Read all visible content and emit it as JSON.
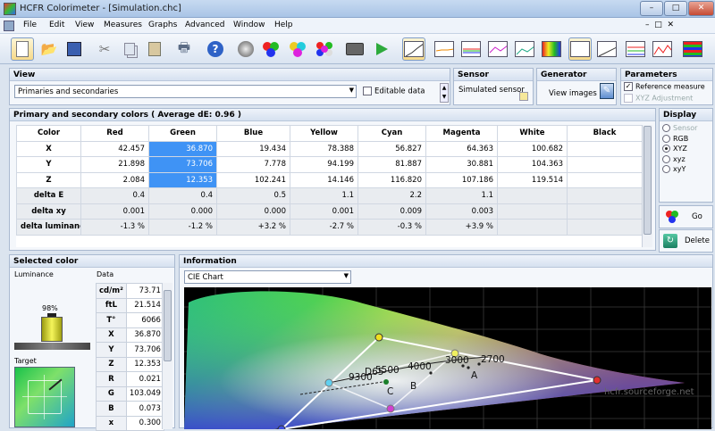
{
  "window": {
    "title": "HCFR Colorimeter - [Simulation.chc]",
    "min": "–",
    "max": "□",
    "close": "✕"
  },
  "menu": [
    "File",
    "Edit",
    "View",
    "Measures",
    "Graphs",
    "Advanced",
    "Window",
    "Help"
  ],
  "view": {
    "header": "View",
    "select": "Primaries and secondaries",
    "editable_label": "Editable data"
  },
  "sensor": {
    "header": "Sensor",
    "label": "Simulated sensor"
  },
  "generator": {
    "header": "Generator",
    "label": "View images"
  },
  "parameters": {
    "header": "Parameters",
    "reference": "Reference measure",
    "xyz_adj": "XYZ Adjustment"
  },
  "primaries": {
    "header": "Primary and secondary colors ( Average dE: 0.96 )",
    "columns": [
      "Color",
      "Red",
      "Green",
      "Blue",
      "Yellow",
      "Cyan",
      "Magenta",
      "White",
      "Black"
    ],
    "rows": [
      [
        "X",
        "42.457",
        "36.870",
        "19.434",
        "78.388",
        "56.827",
        "64.363",
        "100.682",
        ""
      ],
      [
        "Y",
        "21.898",
        "73.706",
        "7.778",
        "94.199",
        "81.887",
        "30.881",
        "104.363",
        ""
      ],
      [
        "Z",
        "2.084",
        "12.353",
        "102.241",
        "14.146",
        "116.820",
        "107.186",
        "119.514",
        ""
      ],
      [
        "delta E",
        "0.4",
        "0.4",
        "0.5",
        "1.1",
        "2.2",
        "1.1",
        "",
        ""
      ],
      [
        "delta xy",
        "0.001",
        "0.000",
        "0.000",
        "0.001",
        "0.009",
        "0.003",
        "",
        ""
      ],
      [
        "delta luminance",
        "-1.3 %",
        "-1.2 %",
        "+3.2 %",
        "-2.7 %",
        "-0.3 %",
        "+3.9 %",
        "",
        ""
      ]
    ]
  },
  "display": {
    "header": "Display",
    "options": [
      "Sensor",
      "RGB",
      "XYZ",
      "xyz",
      "xyY"
    ],
    "selected": "XYZ",
    "go": "Go",
    "delete": "Delete"
  },
  "selected": {
    "header": "Selected color",
    "luminance_label": "Luminance",
    "data_label": "Data",
    "luminance_value": "98%",
    "target_label": "Target",
    "data": [
      [
        "cd/m²",
        "73.71"
      ],
      [
        "ftL",
        "21.514"
      ],
      [
        "T°",
        "6066"
      ],
      [
        "X",
        "36.870"
      ],
      [
        "Y",
        "73.706"
      ],
      [
        "Z",
        "12.353"
      ],
      [
        "R",
        "0.021"
      ],
      [
        "G",
        "103.049"
      ],
      [
        "B",
        "0.073"
      ],
      [
        "x",
        "0.300"
      ]
    ]
  },
  "information": {
    "header": "Information",
    "select": "CIE Chart",
    "labels": {
      "d65": "D65",
      "t9300": "9300",
      "t5500": "5500",
      "t4000": "4000",
      "t3000": "3000",
      "t2700": "2700",
      "a": "A",
      "b": "B",
      "c": "C",
      "watermark": "hcfr.sourceforge.net"
    }
  }
}
